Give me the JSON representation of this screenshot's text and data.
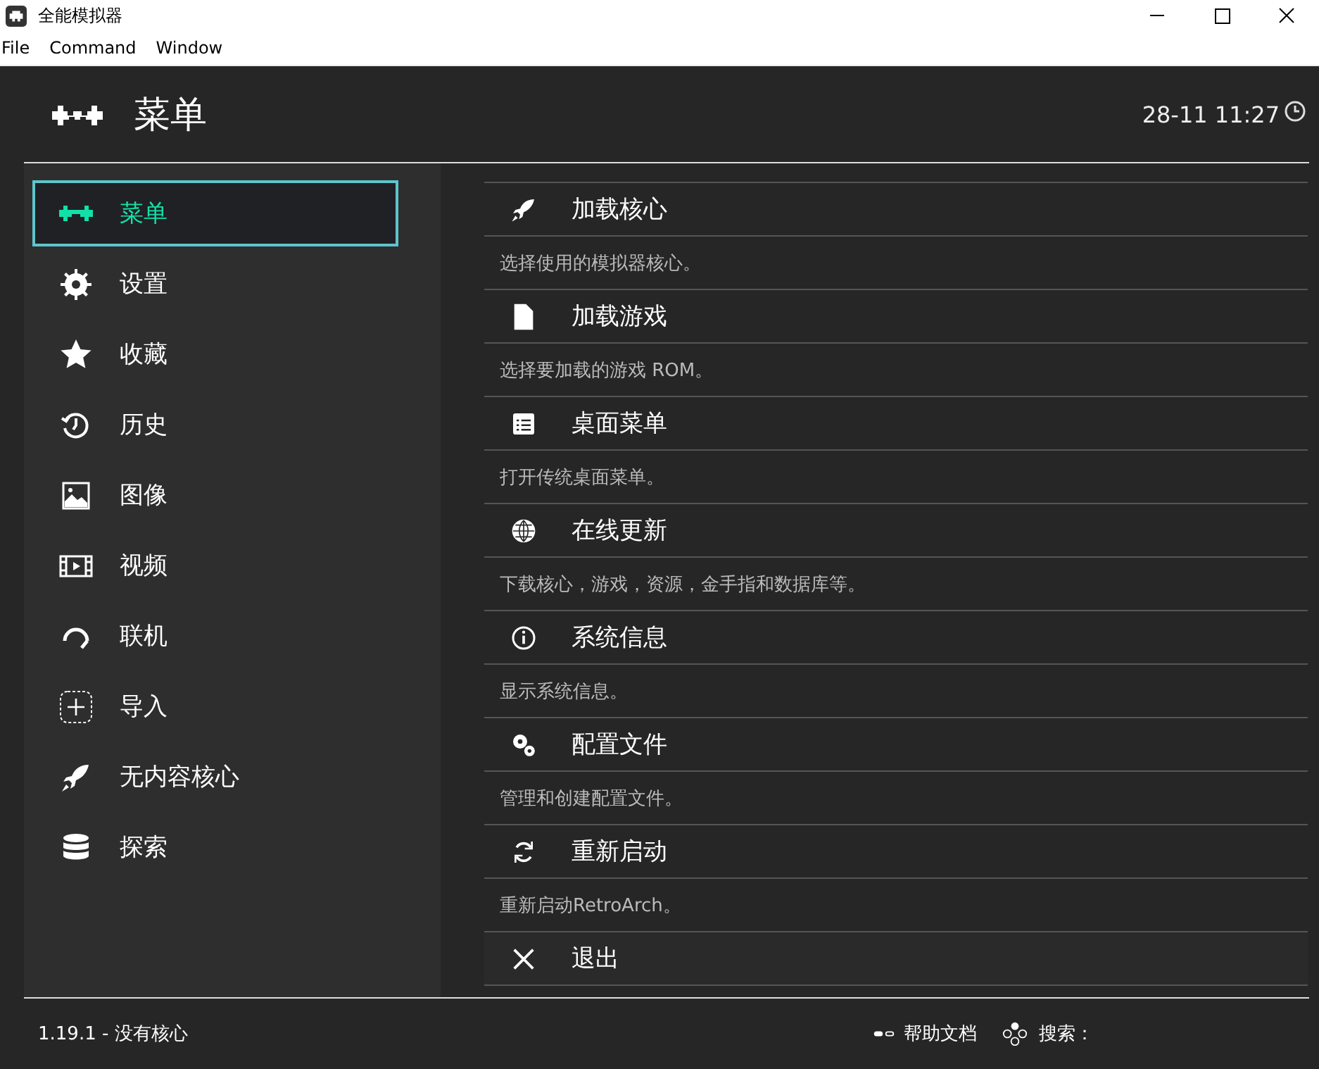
{
  "window": {
    "title": "全能模拟器"
  },
  "menu_bar": [
    "File",
    "Command",
    "Window"
  ],
  "header": {
    "title": "菜单",
    "clock": "28-11 11:27"
  },
  "sidebar": {
    "items": [
      {
        "label": "菜单",
        "selected": true
      },
      {
        "label": "设置",
        "selected": false
      },
      {
        "label": "收藏",
        "selected": false
      },
      {
        "label": "历史",
        "selected": false
      },
      {
        "label": "图像",
        "selected": false
      },
      {
        "label": "视频",
        "selected": false
      },
      {
        "label": "联机",
        "selected": false
      },
      {
        "label": "导入",
        "selected": false
      },
      {
        "label": "无内容核心",
        "selected": false
      },
      {
        "label": "探索",
        "selected": false
      }
    ]
  },
  "entries": [
    {
      "title": "加载核心",
      "description": "选择使用的模拟器核心。"
    },
    {
      "title": "加载游戏",
      "description": "选择要加载的游戏 ROM。"
    },
    {
      "title": "桌面菜单",
      "description": "打开传统桌面菜单。"
    },
    {
      "title": "在线更新",
      "description": "下载核心，游戏，资源，金手指和数据库等。"
    },
    {
      "title": "系统信息",
      "description": "显示系统信息。"
    },
    {
      "title": "配置文件",
      "description": "管理和创建配置文件。"
    },
    {
      "title": "重新启动",
      "description": "重新启动RetroArch。"
    },
    {
      "title": "退出"
    }
  ],
  "footer": {
    "version": "1.19.1 - 没有核心",
    "help": "帮助文档",
    "search": "搜索："
  }
}
